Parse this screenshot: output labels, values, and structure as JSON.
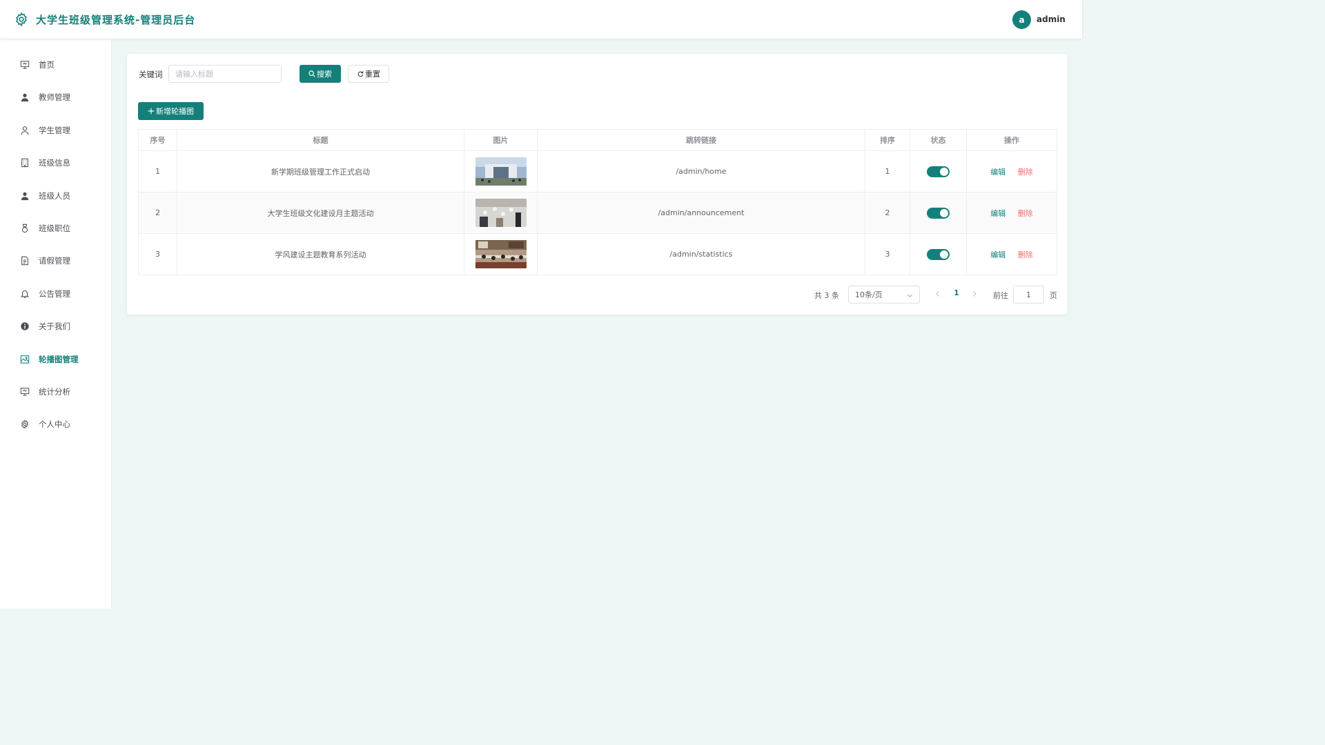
{
  "header": {
    "title": "大学生班级管理系统-管理员后台",
    "avatar_letter": "a",
    "username": "admin"
  },
  "sidebar": {
    "items": [
      {
        "label": "首页",
        "icon": "presentation-icon"
      },
      {
        "label": "教师管理",
        "icon": "user-icon"
      },
      {
        "label": "学生管理",
        "icon": "user-outline-icon"
      },
      {
        "label": "班级信息",
        "icon": "building-icon"
      },
      {
        "label": "班级人员",
        "icon": "user-icon"
      },
      {
        "label": "班级职位",
        "icon": "medal-icon"
      },
      {
        "label": "请假管理",
        "icon": "document-icon"
      },
      {
        "label": "公告管理",
        "icon": "bell-icon"
      },
      {
        "label": "关于我们",
        "icon": "info-icon"
      },
      {
        "label": "轮播图管理",
        "icon": "picture-icon",
        "active": true
      },
      {
        "label": "统计分析",
        "icon": "presentation-icon"
      },
      {
        "label": "个人中心",
        "icon": "gear-icon"
      }
    ]
  },
  "search": {
    "label": "关键词",
    "placeholder": "请输入标题",
    "value": "",
    "search_label": "搜索",
    "reset_label": "重置"
  },
  "toolbar": {
    "add_label": "新增轮播图"
  },
  "table": {
    "columns": [
      "序号",
      "标题",
      "图片",
      "跳转链接",
      "排序",
      "状态",
      "操作"
    ],
    "rows": [
      {
        "index": "1",
        "title": "新学期班级管理工作正式启动",
        "link": "/admin/home",
        "sort": "1",
        "status": true
      },
      {
        "index": "2",
        "title": "大学生班级文化建设月主题活动",
        "link": "/admin/announcement",
        "sort": "2",
        "status": true
      },
      {
        "index": "3",
        "title": "学风建设主题教育系列活动",
        "link": "/admin/statistics",
        "sort": "3",
        "status": true
      }
    ],
    "edit_label": "编辑",
    "delete_label": "删除"
  },
  "pagination": {
    "total": "共 3 条",
    "page_size": "10条/页",
    "current_page": "1",
    "goto_label": "前往",
    "goto_value": "1",
    "page_unit": "页"
  },
  "colors": {
    "primary": "#15807a",
    "danger": "#f56c6c",
    "background": "#eef7f6"
  }
}
